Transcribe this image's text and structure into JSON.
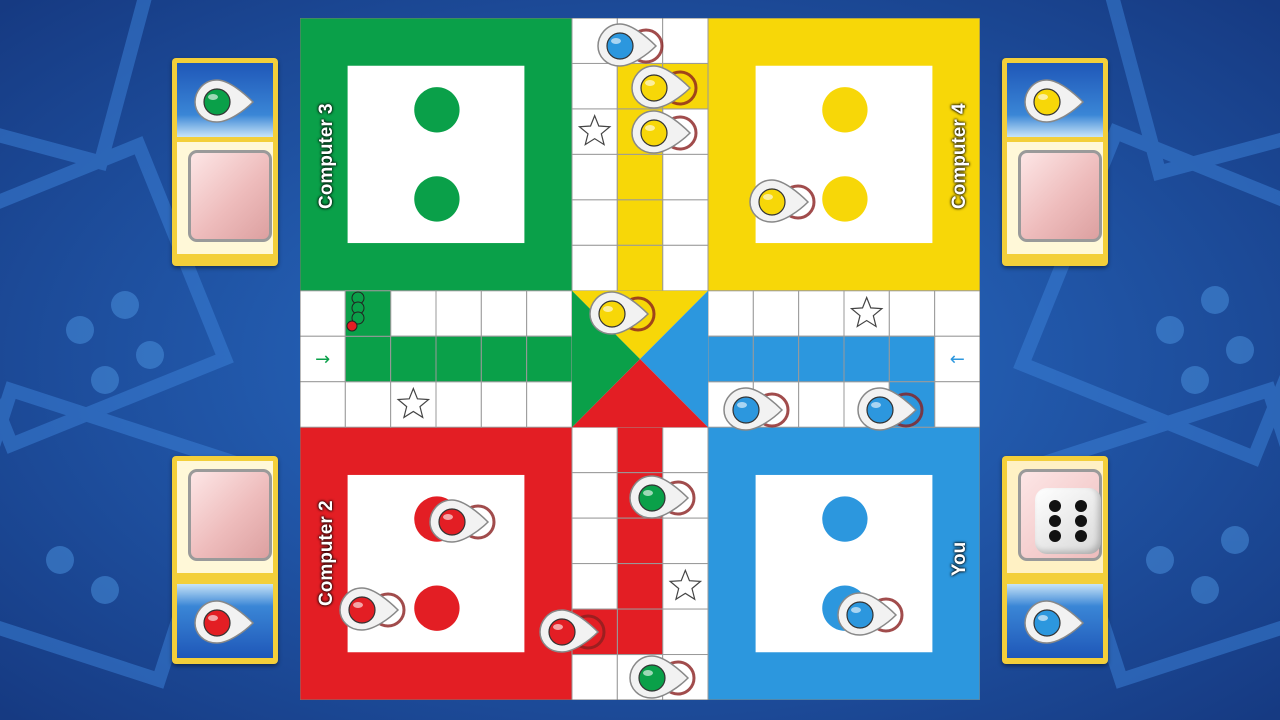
{
  "board": {
    "colors": {
      "green": "#0aa049",
      "yellow": "#f7d708",
      "red": "#e31e24",
      "blue": "#2c97de"
    },
    "players": {
      "top_left": {
        "name": "Computer 3",
        "color": "green"
      },
      "top_right": {
        "name": "Computer 4",
        "color": "yellow"
      },
      "bottom_left": {
        "name": "Computer 2",
        "color": "red"
      },
      "bottom_right": {
        "name": "You",
        "color": "blue"
      }
    }
  },
  "side_panels": {
    "green": {
      "color": "green"
    },
    "yellow": {
      "color": "yellow"
    },
    "red": {
      "color": "red"
    },
    "blue": {
      "color": "blue",
      "dice_value": 6
    }
  },
  "icons": {
    "dice": "dice-six-icon",
    "star": "safe-star-icon",
    "arrow": "entry-arrow-icon"
  },
  "arrows": {
    "left_entry": "→",
    "right_entry": "←"
  },
  "tokens": {
    "blue": {
      "home_slots_filled": 1,
      "on_track": 3
    },
    "yellow": {
      "home_slots_filled": 1,
      "on_track": 3
    },
    "red": {
      "home_slots_filled": 2,
      "on_track": 1
    },
    "green": {
      "home_slots_filled": 0,
      "on_track": 2,
      "finished_stack": 3
    }
  }
}
